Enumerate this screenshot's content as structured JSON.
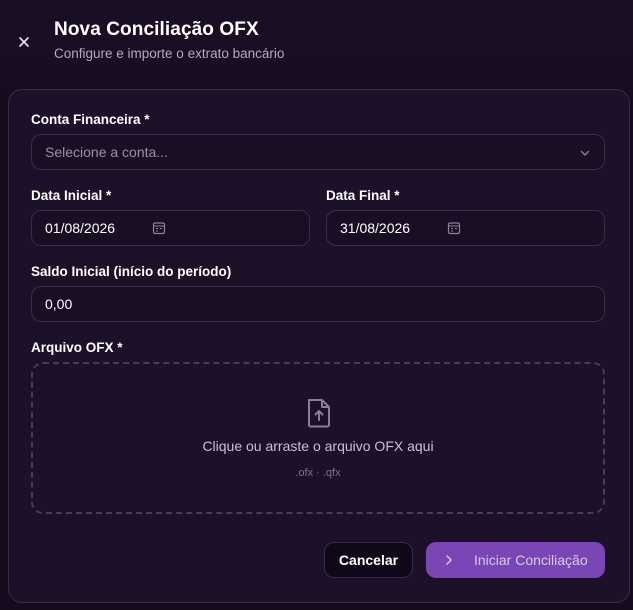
{
  "header": {
    "title": "Nova Conciliação OFX",
    "subtitle": "Configure e importe o extrato bancário"
  },
  "form": {
    "account": {
      "label": "Conta Financeira *",
      "placeholder": "Selecione a conta..."
    },
    "start_date": {
      "label": "Data Inicial *",
      "value": "01/08/2026"
    },
    "end_date": {
      "label": "Data Final *",
      "value": "31/08/2026"
    },
    "initial_balance": {
      "label": "Saldo Inicial (início do período)",
      "value": "0,00"
    },
    "ofx_file": {
      "label": "Arquivo OFX *",
      "drop_text": "Clique ou arraste o arquivo OFX aqui",
      "accepted": ".ofx · .qfx"
    }
  },
  "actions": {
    "cancel_label": "Cancelar",
    "submit_label": "Iniciar Conciliação"
  },
  "icons": {
    "close": "close-icon",
    "chevron": "chevron-down-icon",
    "calendar": "calendar-icon",
    "upload": "file-upload-icon",
    "submit": "chevron-right-icon"
  },
  "colors": {
    "background": "#150b1d",
    "card": "#1d1029",
    "primary": "#7a45b4",
    "border": "#3b2c49"
  }
}
